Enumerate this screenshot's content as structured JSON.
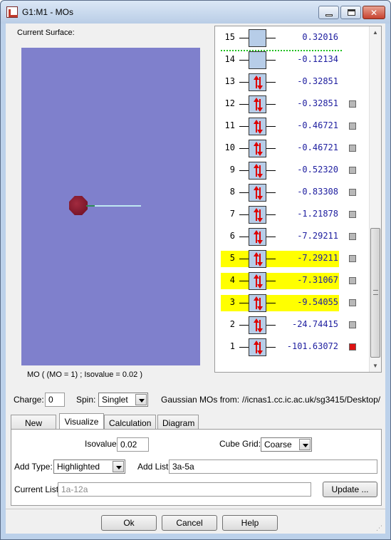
{
  "window": {
    "title": "G1:M1 - MOs",
    "controls": {
      "minimize": "minimize",
      "maximize": "maximize",
      "close": "✕"
    }
  },
  "surface": {
    "group_label": "Current Surface:",
    "caption": "MO ( (MO = 1) ; Isovalue = 0.02 )"
  },
  "mo_list": [
    {
      "num": "15",
      "energy": "0.32016",
      "occupied": false,
      "highlight": false,
      "checkbox": "none"
    },
    {
      "num": "14",
      "energy": "-0.12134",
      "occupied": false,
      "highlight": false,
      "checkbox": "none"
    },
    {
      "num": "13",
      "energy": "-0.32851",
      "occupied": true,
      "highlight": false,
      "checkbox": "none"
    },
    {
      "num": "12",
      "energy": "-0.32851",
      "occupied": true,
      "highlight": false,
      "checkbox": "off"
    },
    {
      "num": "11",
      "energy": "-0.46721",
      "occupied": true,
      "highlight": false,
      "checkbox": "off"
    },
    {
      "num": "10",
      "energy": "-0.46721",
      "occupied": true,
      "highlight": false,
      "checkbox": "off"
    },
    {
      "num": "9",
      "energy": "-0.52320",
      "occupied": true,
      "highlight": false,
      "checkbox": "off"
    },
    {
      "num": "8",
      "energy": "-0.83308",
      "occupied": true,
      "highlight": false,
      "checkbox": "off"
    },
    {
      "num": "7",
      "energy": "-1.21878",
      "occupied": true,
      "highlight": false,
      "checkbox": "off"
    },
    {
      "num": "6",
      "energy": "-7.29211",
      "occupied": true,
      "highlight": false,
      "checkbox": "off"
    },
    {
      "num": "5",
      "energy": "-7.29211",
      "occupied": true,
      "highlight": true,
      "checkbox": "off"
    },
    {
      "num": "4",
      "energy": "-7.31067",
      "occupied": true,
      "highlight": true,
      "checkbox": "off"
    },
    {
      "num": "3",
      "energy": "-9.54055",
      "occupied": true,
      "highlight": true,
      "checkbox": "off"
    },
    {
      "num": "2",
      "energy": "-24.74415",
      "occupied": true,
      "highlight": false,
      "checkbox": "off"
    },
    {
      "num": "1",
      "energy": "-101.63072",
      "occupied": true,
      "highlight": false,
      "checkbox": "on"
    }
  ],
  "colors": {
    "viewport_bg": "#7f80cc",
    "highlight": "#ffff00",
    "energy_text": "#2020a0",
    "electron_arrow": "#dd0000",
    "selected_checkbox": "#dd1111"
  },
  "options": {
    "charge_label": "Charge:",
    "charge_value": "0",
    "spin_label": "Spin:",
    "spin_value": "Singlet",
    "source_label": "Gaussian MOs from:",
    "source_path": "//icnas1.cc.ic.ac.uk/sg3415/Desktop/"
  },
  "tabs": [
    "New MOs",
    "Visualize",
    "Calculation",
    "Diagram"
  ],
  "active_tab": "Visualize",
  "visualize": {
    "isovalue_label": "Isovalue:",
    "isovalue_value": "0.02",
    "cube_grid_label": "Cube Grid:",
    "cube_grid_value": "Coarse",
    "add_type_label": "Add Type:",
    "add_type_value": "Highlighted",
    "add_list_label": "Add List:",
    "add_list_value": "3a-5a",
    "current_list_label": "Current List:",
    "current_list_value": "1a-12a",
    "update_button": "Update ..."
  },
  "buttons": {
    "ok": "Ok",
    "cancel": "Cancel",
    "help": "Help"
  }
}
